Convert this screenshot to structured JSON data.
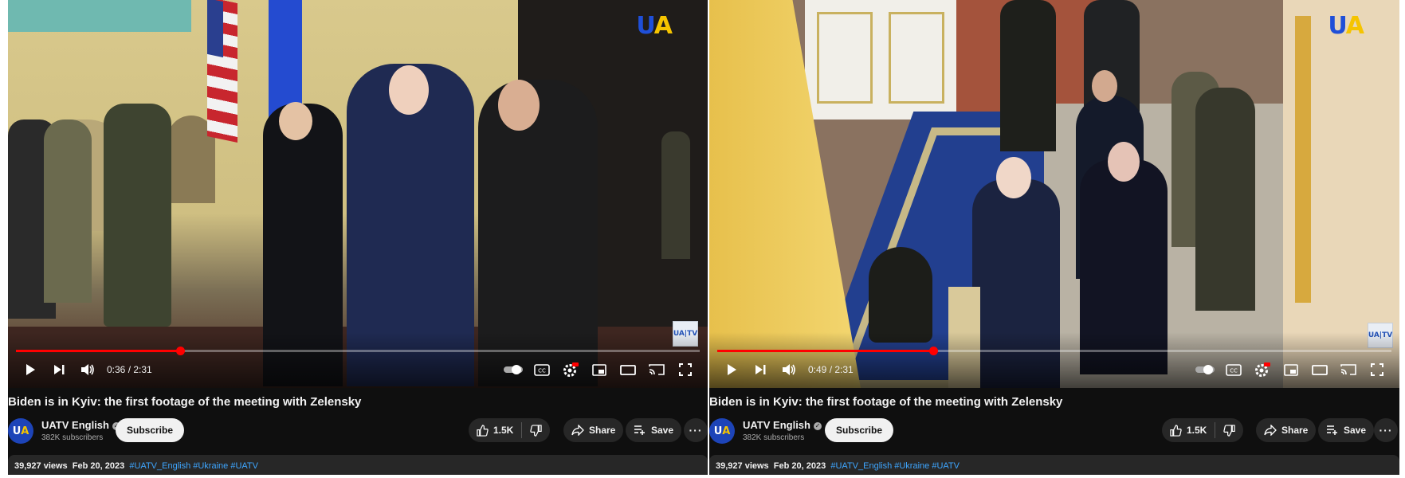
{
  "videos": [
    {
      "watermark": {
        "u": "U",
        "a": "A"
      },
      "badge": "UA|TV",
      "time": "0:36 / 2:31",
      "progress": 0.24,
      "title": "Biden is in Kyiv: the first footage of the meeting with Zelensky",
      "channel": {
        "name": "UATV English",
        "subs": "382K subscribers",
        "avatar_u": "U",
        "avatar_a": "A"
      },
      "subscribe": "Subscribe",
      "likes": "1.5K",
      "share": "Share",
      "save": "Save",
      "views": "39,927 views",
      "date": "Feb 20, 2023",
      "tags": "#UATV_English #Ukraine #UATV"
    },
    {
      "watermark": {
        "u": "U",
        "a": "A"
      },
      "badge": "UA|TV",
      "time": "0:49 / 2:31",
      "progress": 0.32,
      "title": "Biden is in Kyiv: the first footage of the meeting with Zelensky",
      "channel": {
        "name": "UATV English",
        "subs": "382K subscribers",
        "avatar_u": "U",
        "avatar_a": "A"
      },
      "subscribe": "Subscribe",
      "likes": "1.5K",
      "share": "Share",
      "save": "Save",
      "views": "39,927 views",
      "date": "Feb 20, 2023",
      "tags": "#UATV_English #Ukraine #UATV"
    }
  ],
  "icons": [
    "play-icon",
    "next-icon",
    "volume-icon",
    "autoplay-toggle-icon",
    "captions-icon",
    "settings-icon",
    "miniplayer-icon",
    "theater-icon",
    "cast-icon",
    "fullscreen-icon",
    "like-icon",
    "dislike-icon",
    "share-icon",
    "save-icon",
    "more-icon"
  ],
  "colors": {
    "progress": "#ff0000",
    "ua_blue": "#1f4fd8",
    "ua_yellow": "#f5c400",
    "tag": "#3ea6ff"
  }
}
